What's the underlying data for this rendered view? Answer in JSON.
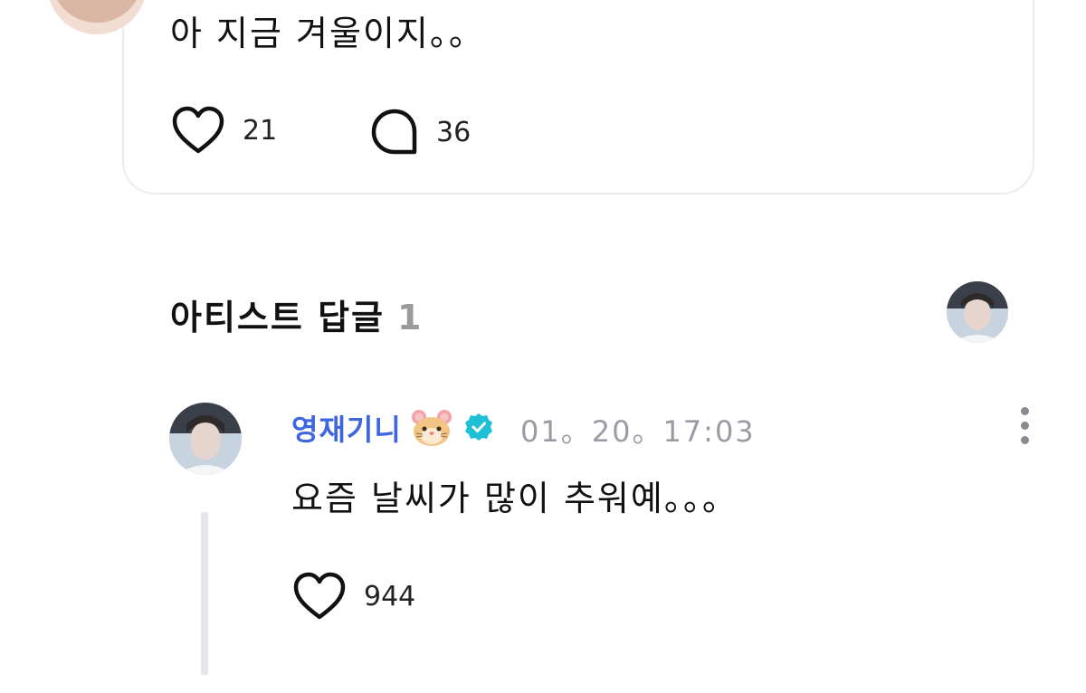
{
  "post": {
    "text": "아 지금 겨울이지。。",
    "likes": "21",
    "comments": "36"
  },
  "section": {
    "title": "아티스트 답글",
    "count": "1"
  },
  "reply": {
    "author": "영재기니",
    "author_emoji": "hamster-face-icon",
    "verified": true,
    "timestamp": "01。20。17:03",
    "text": "요즘 날씨가 많이 추워예。。。",
    "likes": "944"
  },
  "colors": {
    "author": "#3d66e0",
    "verified_badge": "#1fc0d6",
    "muted": "#9b9ba5",
    "thread_line": "#e6e6ec"
  }
}
